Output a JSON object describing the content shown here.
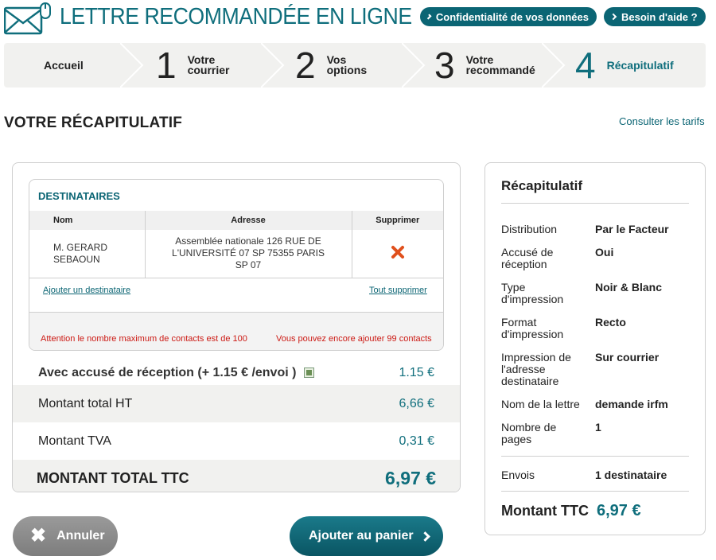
{
  "header": {
    "title": "LETTRE RECOMMANDÉE EN LIGNE",
    "privacy_link": "Confidentialité de vos données",
    "help_link": "Besoin d'aide ?"
  },
  "steps": [
    {
      "num": "",
      "label": "Accueil"
    },
    {
      "num": "1",
      "label_line1": "Votre",
      "label_line2": "courrier"
    },
    {
      "num": "2",
      "label_line1": "Vos",
      "label_line2": "options"
    },
    {
      "num": "3",
      "label_line1": "Votre",
      "label_line2": "recommandé"
    },
    {
      "num": "4",
      "label": "Récapitulatif",
      "active": true
    }
  ],
  "page": {
    "title": "VOTRE RÉCAPITULATIF",
    "tarifs_link": "Consulter les tarifs"
  },
  "recipients": {
    "title": "DESTINATAIRES",
    "columns": [
      "Nom",
      "Adresse",
      "Supprimer"
    ],
    "rows": [
      {
        "name_line1": "M. GERARD",
        "name_line2": "SEBAOUN",
        "addr_line1": "Assemblée nationale 126 RUE DE",
        "addr_line2": "L'UNIVERSITÉ 07 SP 75355 PARIS",
        "addr_line3": "SP 07"
      }
    ],
    "add_link": "Ajouter un destinataire",
    "clear_link": "Tout supprimer",
    "warning_max": "Attention le nombre maximum de contacts est de 100",
    "warning_remaining": "Vous pouvez encore ajouter 99 contacts"
  },
  "pricing": {
    "ar_label": "Avec accusé de réception (+ 1.15 € /envoi )",
    "ar_checked": true,
    "ar_value": "1.15 €",
    "ht_label": "Montant total HT",
    "ht_value": "6,66 €",
    "tva_label": "Montant TVA",
    "tva_value": "0,31 €",
    "ttc_label": "MONTANT TOTAL TTC",
    "ttc_value": "6,97 €"
  },
  "buttons": {
    "cancel": "Annuler",
    "add_to_cart": "Ajouter au panier"
  },
  "summary": {
    "title": "Récapitulatif",
    "items": [
      {
        "key": "Distribution",
        "value": "Par le Facteur"
      },
      {
        "key_line1": "Accusé de",
        "key_line2": "réception",
        "value": "Oui"
      },
      {
        "key_line1": "Type",
        "key_line2": "d'impression",
        "value": "Noir & Blanc"
      },
      {
        "key_line1": "Format",
        "key_line2": "d'impression",
        "value": "Recto"
      },
      {
        "key_line1": "Impression de",
        "key_line2": "l'adresse",
        "key_line3": "destinataire",
        "value": "Sur courrier"
      },
      {
        "key": "Nom de la lettre",
        "value": "demande irfm"
      },
      {
        "key_line1": "Nombre de",
        "key_line2": "pages",
        "value": "1"
      },
      {
        "key": "Envois",
        "value": "1 destinataire"
      }
    ],
    "total_label": "Montant TTC",
    "total_value": "6,97 €"
  },
  "colors": {
    "brand": "#0f6e7c",
    "brand_dark": "#0b6574",
    "warning": "#cc1a14",
    "delete": "#e0501c"
  }
}
